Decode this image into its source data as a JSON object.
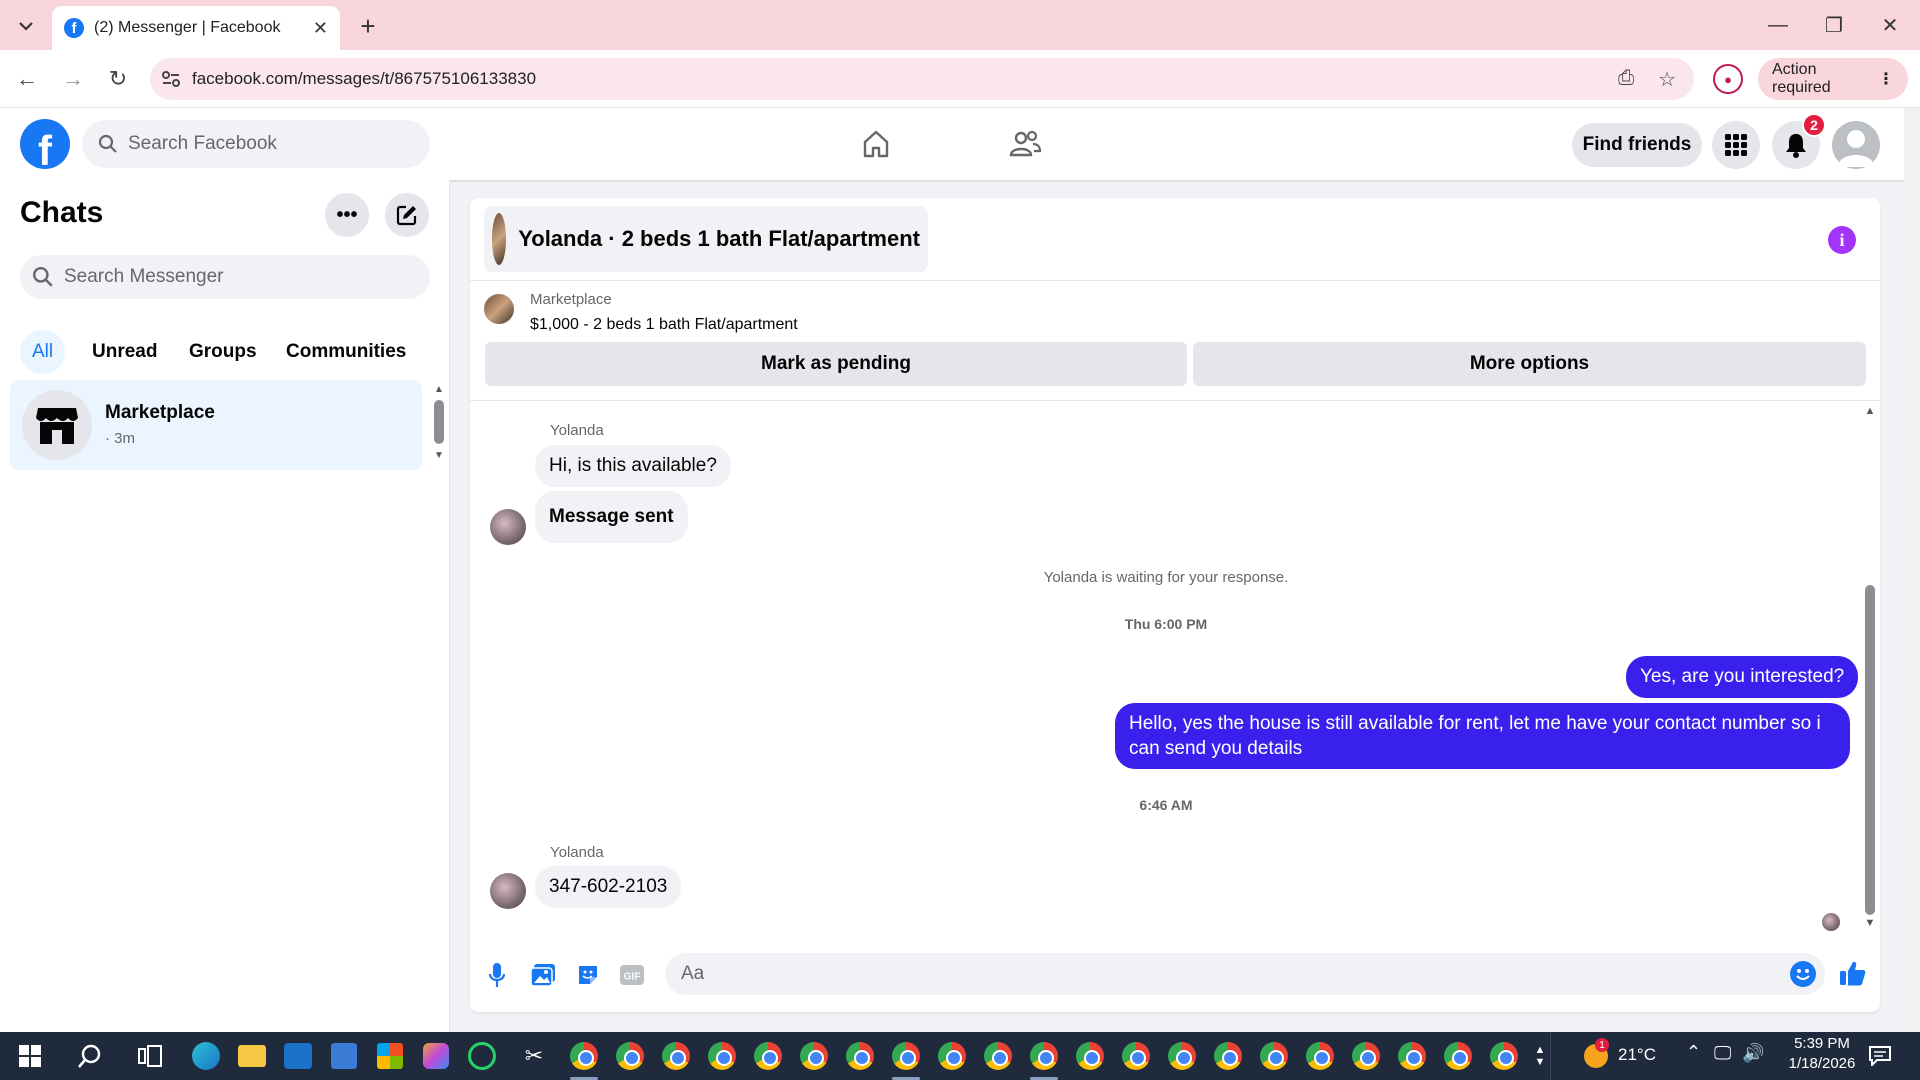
{
  "browser": {
    "tab_title": "(2) Messenger | Facebook",
    "url": "facebook.com/messages/t/867575106133830",
    "action_required": "Action required"
  },
  "fb": {
    "search_placeholder": "Search Facebook",
    "find_friends": "Find friends",
    "notification_count": "2"
  },
  "chats": {
    "title": "Chats",
    "search_placeholder": "Search Messenger",
    "filters": [
      "All",
      "Unread",
      "Groups",
      "Communities"
    ],
    "items": [
      {
        "name": "Marketplace",
        "time": "· 3m"
      }
    ]
  },
  "conversation": {
    "title": "Yolanda · 2 beds 1 bath Flat/apartment",
    "marketplace_label": "Marketplace",
    "listing": "$1,000 - 2 beds 1 bath Flat/apartment",
    "mark_pending": "Mark as pending",
    "more_options": "More options",
    "messages": {
      "sender1": "Yolanda",
      "in1": "Hi, is this available?",
      "in2": "Message sent",
      "waiting": "Yolanda is waiting for your response.",
      "ts1": "Thu 6:00 PM",
      "out1": "Yes, are you interested?",
      "out2": "Hello, yes the house is still available for rent, let me have your contact number so i can send you details",
      "ts2": "6:46 AM",
      "sender2": "Yolanda",
      "in3": "347-602-2103"
    },
    "composer_placeholder": "Aa"
  },
  "taskbar": {
    "weather_temp": "21°C",
    "time": "5:39 PM",
    "date": "1/18/2026",
    "weather_badge": "1"
  },
  "colors": {
    "fb_blue": "#1877f2",
    "outgoing_bubble": "#3a20ed",
    "tabstrip": "#f9d5dc",
    "info_purple": "#a334fa"
  },
  "icons": [
    "facebook-logo-icon",
    "home-icon",
    "friends-icon",
    "grid-menu-icon",
    "bell-icon",
    "search-icon",
    "more-icon",
    "compose-icon",
    "storefront-icon",
    "info-icon",
    "mic-icon",
    "photo-icon",
    "sticker-icon",
    "gif-icon",
    "emoji-icon",
    "like-icon"
  ]
}
